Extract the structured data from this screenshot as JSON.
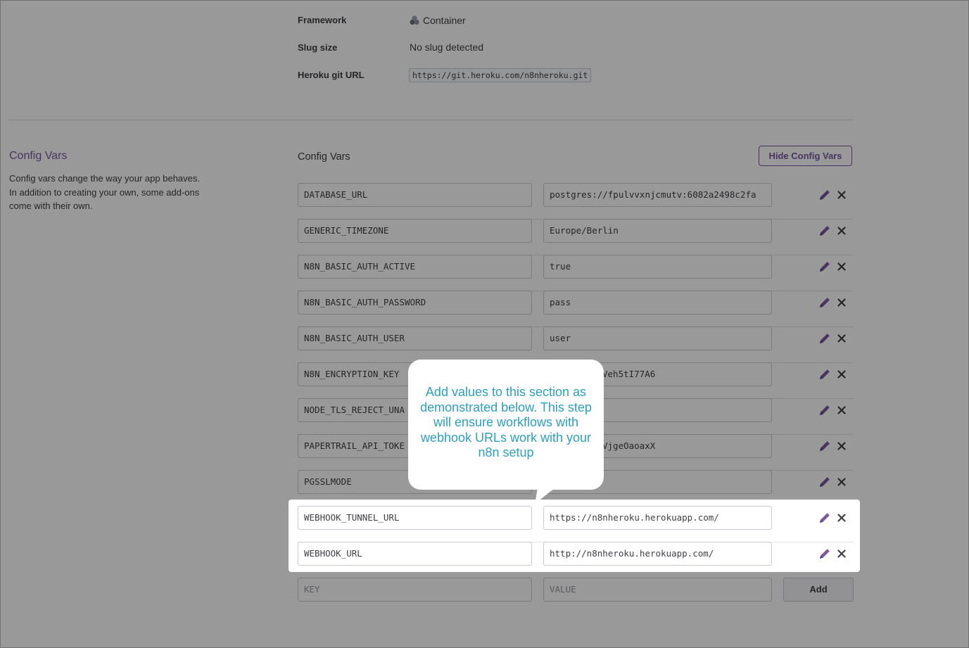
{
  "info": {
    "framework": {
      "label": "Framework",
      "icon": "container-icon",
      "value": "Container"
    },
    "slug_size": {
      "label": "Slug size",
      "value": "No slug detected"
    },
    "git_url": {
      "label": "Heroku git URL",
      "value": "https://git.heroku.com/n8nheroku.git"
    }
  },
  "config_section": {
    "title": "Config Vars",
    "description": "Config vars change the way your app behaves. In addition to creating your own, some add-ons come with their own.",
    "panel_title": "Config Vars",
    "hide_button": "Hide Config Vars"
  },
  "config_vars": [
    {
      "key": "DATABASE_URL",
      "value": "postgres://fpulvvxnjcmutv:6082a2498c2fa"
    },
    {
      "key": "GENERIC_TIMEZONE",
      "value": "Europe/Berlin"
    },
    {
      "key": "N8N_BASIC_AUTH_ACTIVE",
      "value": "true"
    },
    {
      "key": "N8N_BASIC_AUTH_PASSWORD",
      "value": "pass"
    },
    {
      "key": "N8N_BASIC_AUTH_USER",
      "value": "user"
    },
    {
      "key": "N8N_ENCRYPTION_KEY",
      "value": "Veh5tI77A6"
    },
    {
      "key": "NODE_TLS_REJECT_UNA",
      "value": ""
    },
    {
      "key": "PAPERTRAIL_API_TOKE",
      "value": "VjgeOaoaxX"
    },
    {
      "key": "PGSSLMODE",
      "value": ""
    },
    {
      "key": "WEBHOOK_TUNNEL_URL",
      "value": "https://n8nheroku.herokuapp.com/"
    },
    {
      "key": "WEBHOOK_URL",
      "value": "http://n8nheroku.herokuapp.com/"
    }
  ],
  "new_var": {
    "key_placeholder": "KEY",
    "value_placeholder": "VALUE",
    "add_button": "Add"
  },
  "callout": {
    "text": "Add values to this section as demonstrated below. This step will ensure workflows with webhook URLs work with your n8n setup"
  },
  "colors": {
    "accent": "#79589f",
    "callout_text": "#2c9fbd",
    "overlay": "rgba(0,0,0,0.40)"
  }
}
